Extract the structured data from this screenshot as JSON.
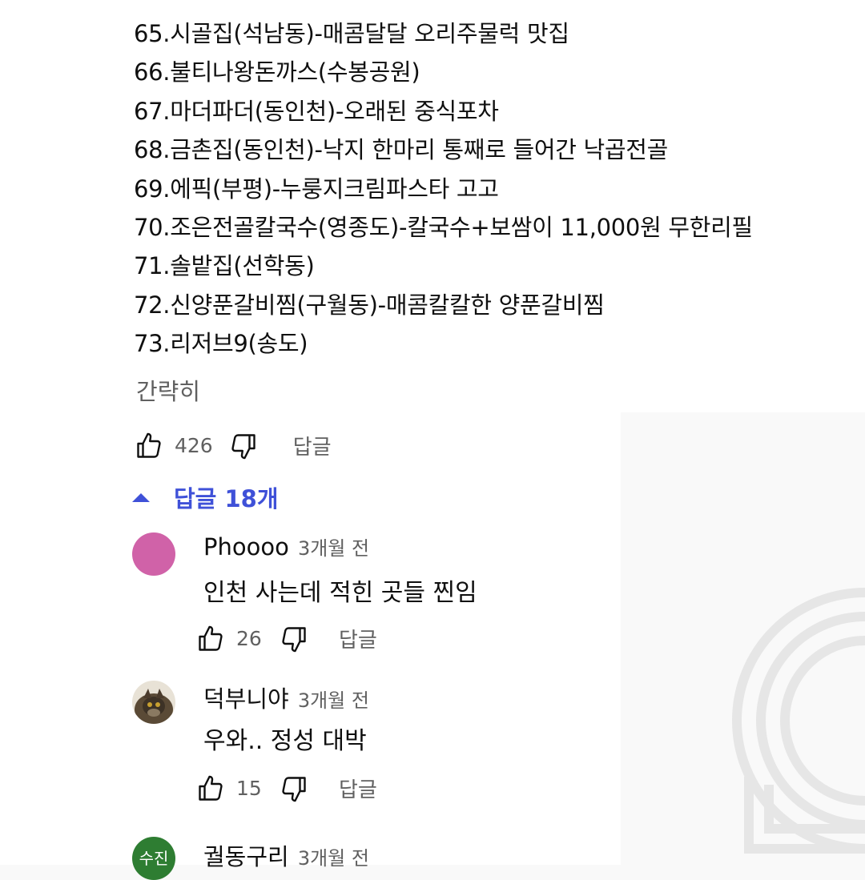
{
  "list_lines": [
    "65.시골집(석남동)-매콤달달 오리주물럭 맛집",
    "66.불티나왕돈까스(수봉공원)",
    "67.마더파더(동인천)-오래된 중식포차",
    "68.금촌집(동인천)-낙지 한마리 통째로 들어간 낙곱전골",
    "69.에픽(부평)-누룽지크림파스타 고고",
    "70.조은전골칼국수(영종도)-칼국수+보쌈이 11,000원 무한리필",
    "71.솔밭집(선학동)",
    "72.신양푼갈비찜(구월동)-매콤칼칼한 양푼갈비찜",
    "73.리저브9(송도)"
  ],
  "collapse_label": "간략히",
  "main_actions": {
    "like_count": "426",
    "reply_label": "답글"
  },
  "replies_toggle": "답글 18개",
  "replies": [
    {
      "name": "Phoooo",
      "time": "3개월 전",
      "text": "인천 사는데 적힌 곳들 찐임",
      "likes": "26",
      "reply_label": "답글",
      "avatar": "pink-circle"
    },
    {
      "name": "덕부니야",
      "time": "3개월 전",
      "text": "우와.. 정성 대박",
      "likes": "15",
      "reply_label": "답글",
      "avatar": "cat-photo"
    },
    {
      "name": "궐동구리",
      "time": "3개월 전",
      "avatar_text": "수진",
      "avatar": "green-circle"
    }
  ],
  "colors": {
    "accent": "#3f51d8",
    "pink_avatar": "#d062a8",
    "green_avatar": "#2e7d32",
    "secondary_text": "#606060"
  }
}
